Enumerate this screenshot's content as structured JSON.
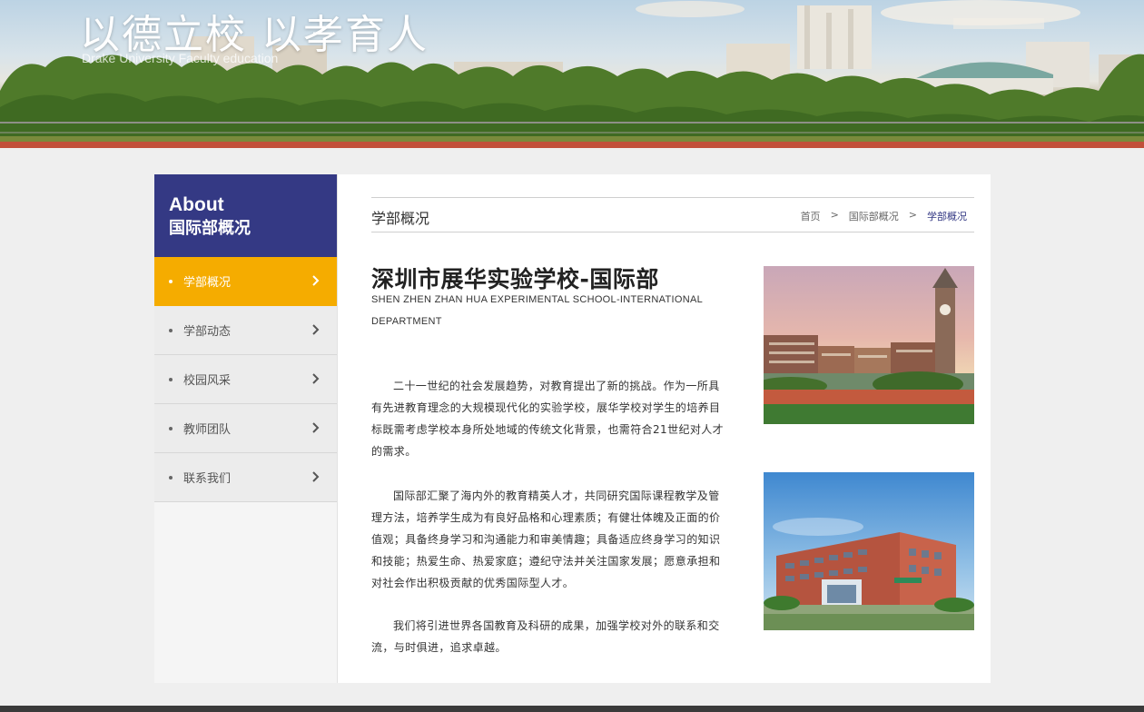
{
  "banner": {
    "slogan": "以德立校 以孝育人",
    "subtitle": "Drake University Faculty education"
  },
  "sidebar": {
    "title_en": "About",
    "title_cn": "国际部概况",
    "items": [
      {
        "label": "学部概况",
        "active": true
      },
      {
        "label": "学部动态",
        "active": false
      },
      {
        "label": "校园风采",
        "active": false
      },
      {
        "label": "教师团队",
        "active": false
      },
      {
        "label": "联系我们",
        "active": false
      }
    ]
  },
  "main": {
    "page_title": "学部概况",
    "breadcrumb": [
      "首页",
      "国际部概况",
      "学部概况"
    ],
    "breadcrumb_sep": ">",
    "school_name": "深圳市展华实验学校-国际部",
    "school_name_en": "SHEN ZHEN ZHAN HUA EXPERIMENTAL SCHOOL-INTERNATIONAL DEPARTMENT",
    "paragraphs": [
      "二十一世纪的社会发展趋势，对教育提出了新的挑战。作为一所具有先进教育理念的大规模现代化的实验学校，展华学校对学生的培养目标既需考虑学校本身所处地域的传统文化背景，也需符合21世纪对人才的需求。",
      "国际部汇聚了海内外的教育精英人才，共同研究国际课程教学及管理方法，培养学生成为有良好品格和心理素质；有健壮体魄及正面的价值观；具备终身学习和沟通能力和审美情趣；具备适应终身学习的知识和技能；热爱生命、热爱家庭；遵纪守法并关注国家发展；愿意承担和对社会作出积极贡献的优秀国际型人才。",
      "我们将引进世界各国教育及科研的成果，加强学校对外的联系和交流，与时俱进，追求卓越。"
    ]
  },
  "colors": {
    "sidebar_header": "#343984",
    "active_item": "#f5ac00",
    "breadcrumb_current": "#343984"
  },
  "icons": {
    "nav_arrow": "chevron-right-icon"
  }
}
